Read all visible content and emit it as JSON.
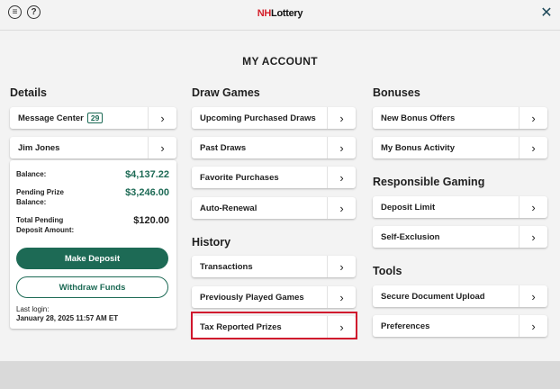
{
  "header": {
    "menu_icon_glyph": "≡",
    "help_icon_glyph": "?",
    "logo_nh": "NH",
    "logo_lottery": "Lottery",
    "close_glyph": "✕"
  },
  "page": {
    "title": "MY ACCOUNT"
  },
  "details": {
    "heading": "Details",
    "message_center": {
      "label": "Message Center",
      "badge": "29"
    },
    "user_name": "Jim Jones",
    "balance_label": "Balance:",
    "balance_value": "$4,137.22",
    "pending_prize_label_1": "Pending Prize",
    "pending_prize_label_2": "Balance:",
    "pending_prize_value": "$3,246.00",
    "total_pending_label_1": "Total Pending",
    "total_pending_label_2": "Deposit Amount:",
    "total_pending_value": "$120.00",
    "make_deposit": "Make Deposit",
    "withdraw_funds": "Withdraw Funds",
    "last_login_label": "Last login:",
    "last_login_value": "January 28, 2025 11:57 AM ET"
  },
  "draw_games": {
    "heading": "Draw Games",
    "items": [
      "Upcoming Purchased Draws",
      "Past Draws",
      "Favorite Purchases",
      "Auto-Renewal"
    ]
  },
  "history": {
    "heading": "History",
    "items": [
      "Transactions",
      "Previously Played Games",
      "Tax Reported Prizes"
    ]
  },
  "bonuses": {
    "heading": "Bonuses",
    "items": [
      "New Bonus Offers",
      "My Bonus Activity"
    ]
  },
  "responsible_gaming": {
    "heading": "Responsible Gaming",
    "items": [
      "Deposit Limit",
      "Self-Exclusion"
    ]
  },
  "tools": {
    "heading": "Tools",
    "items": [
      "Secure Document Upload",
      "Preferences"
    ]
  },
  "chevron_glyph": "›",
  "colors": {
    "accent": "#1d6a55",
    "highlight": "#d0162d",
    "brand_red": "#d41f2a"
  }
}
